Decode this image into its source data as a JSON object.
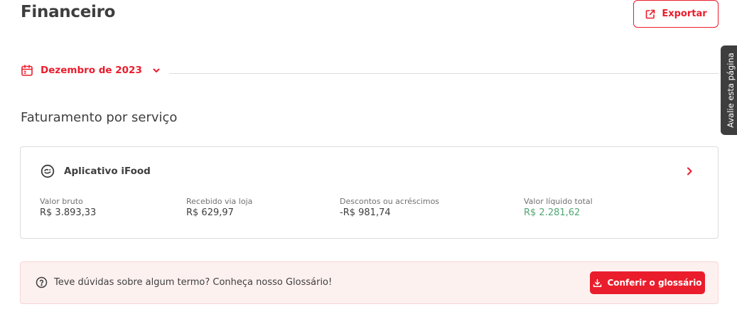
{
  "page": {
    "title": "Financeiro",
    "export_label": "Exportar"
  },
  "period": {
    "selected": "Dezembro de 2023"
  },
  "feedback_tab": {
    "label": "Avalie esta página"
  },
  "section": {
    "title": "Faturamento por serviço"
  },
  "service_card": {
    "name": "Aplicativo iFood",
    "metrics": [
      {
        "label": "Valor bruto",
        "value": "R$ 3.893,33"
      },
      {
        "label": "Recebido via loja",
        "value": "R$ 629,97"
      },
      {
        "label": "Descontos ou acréscimos",
        "value": "-R$ 981,74"
      },
      {
        "label": "Valor líquido total",
        "value": "R$ 2.281,62"
      }
    ]
  },
  "glossary_banner": {
    "text": "Teve dúvidas sobre algum termo? Conheça nosso Glossário!",
    "button_label": "Conferir o glossário"
  },
  "colors": {
    "brand_red": "#ea1d2c",
    "positive_green": "#50a773",
    "text_dark": "#3e3e3e",
    "banner_bg": "#fdf1f0"
  },
  "icons": {
    "export": "external-link-icon",
    "calendar": "calendar-icon",
    "chevron_down": "chevron-down-icon",
    "service": "ifood-logo-icon",
    "chevron_right": "chevron-right-icon",
    "help": "question-circle-icon",
    "download": "download-icon"
  }
}
